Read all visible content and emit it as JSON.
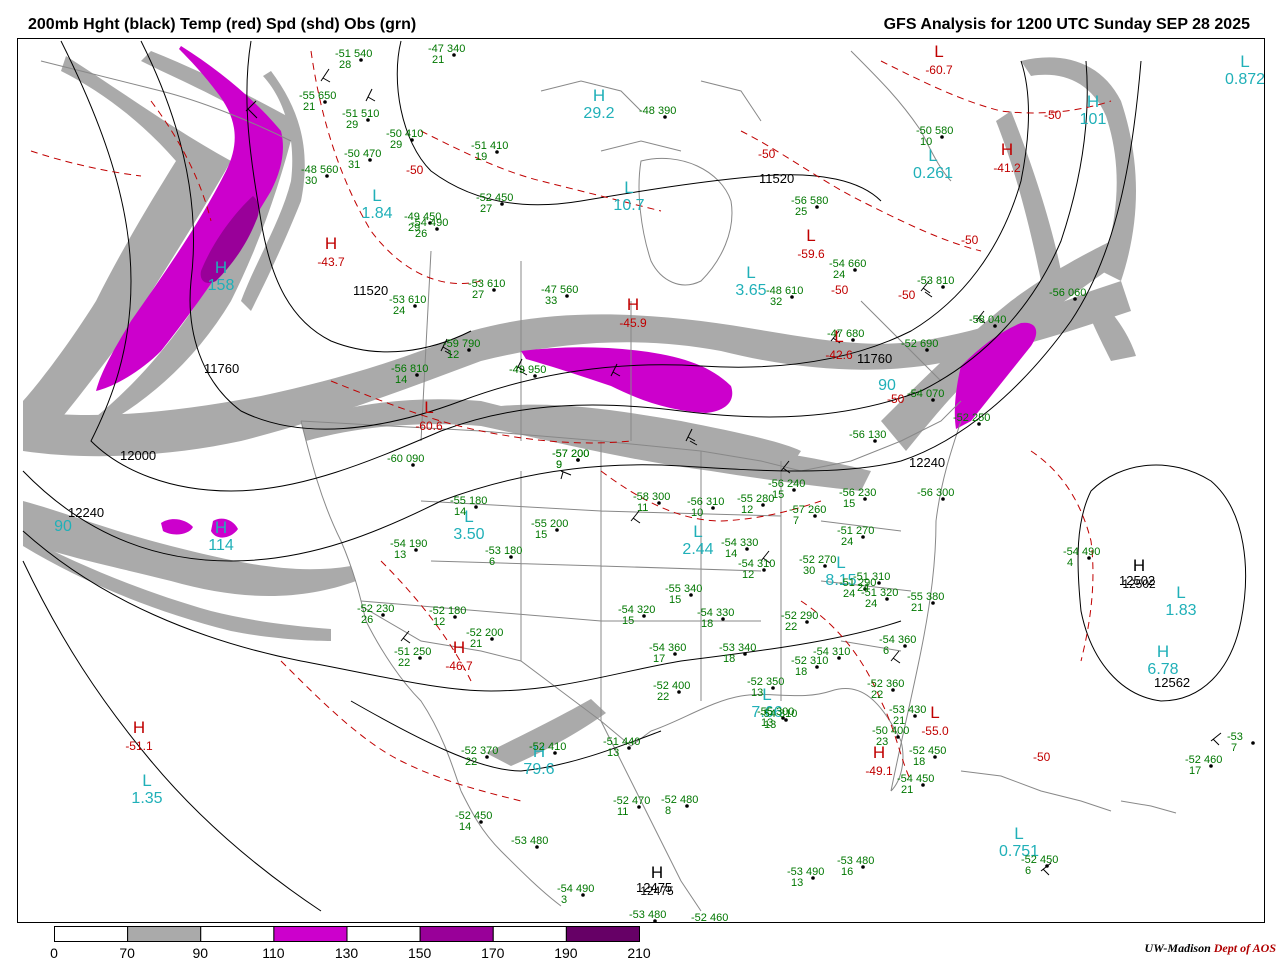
{
  "header": {
    "left": "200mb Hght (black) Temp (red) Spd (shd) Obs (grn)",
    "right": "GFS Analysis for 1200 UTC Sunday  SEP 28 2025"
  },
  "colors": {
    "height_contour": "#000000",
    "temp_contour": "#c00000",
    "obs": "#007700",
    "pressure_center": "#20b0b8",
    "boundary": "#888888",
    "wind_70_90": "#aaaaaa",
    "wind_90_110": "#ffffff",
    "wind_110_130": "#cc00cc",
    "wind_130_150": "#ffffff",
    "wind_150_170": "#990099",
    "wind_170_190": "#ffffff",
    "wind_190_210": "#660066"
  },
  "legend": {
    "ticks": [
      "0",
      "70",
      "90",
      "110",
      "130",
      "150",
      "170",
      "190",
      "210"
    ],
    "fills": [
      "#ffffff",
      "#aaaaaa",
      "#ffffff",
      "#cc00cc",
      "#ffffff",
      "#990099",
      "#ffffff",
      "#660066"
    ]
  },
  "height_labels": [
    "11520",
    "11520",
    "11760",
    "11760",
    "12000",
    "12240",
    "12240",
    "12502",
    "12475",
    "12562"
  ],
  "centers": [
    {
      "sym": "H",
      "value": "29.2",
      "color": "cyan"
    },
    {
      "sym": "L",
      "value": "10.7",
      "color": "cyan"
    },
    {
      "sym": "L",
      "value": "3.65",
      "color": "cyan"
    },
    {
      "sym": "L",
      "value": "0.261",
      "color": "cyan"
    },
    {
      "sym": "H",
      "value": "101",
      "color": "cyan"
    },
    {
      "sym": "L",
      "value": "0.872",
      "color": "cyan"
    },
    {
      "sym": "L",
      "value": "1.84",
      "color": "cyan"
    },
    {
      "sym": "L",
      "value": "3.50",
      "color": "cyan"
    },
    {
      "sym": "L",
      "value": "2.44",
      "color": "cyan"
    },
    {
      "sym": "L",
      "value": "8.15",
      "color": "cyan"
    },
    {
      "sym": "L",
      "value": "1.83",
      "color": "cyan"
    },
    {
      "sym": "H",
      "value": "6.78",
      "color": "cyan"
    },
    {
      "sym": "L",
      "value": "0.751",
      "color": "cyan"
    },
    {
      "sym": "L",
      "value": "1.35",
      "color": "cyan"
    },
    {
      "sym": "H",
      "value": "79.6",
      "color": "cyan"
    },
    {
      "sym": "L",
      "value": "7.66",
      "color": "cyan"
    },
    {
      "sym": "H",
      "value": "158",
      "color": "cyan"
    },
    {
      "sym": "H",
      "value": "114",
      "color": "cyan"
    },
    {
      "sym": "",
      "value": "90",
      "color": "cyan"
    },
    {
      "sym": "",
      "value": "90",
      "color": "cyan"
    },
    {
      "sym": "H",
      "value": "-43.7",
      "color": "red"
    },
    {
      "sym": "H",
      "value": "-45.9",
      "color": "red"
    },
    {
      "sym": "L",
      "value": "-60.7",
      "color": "red"
    },
    {
      "sym": "H",
      "value": "-41.2",
      "color": "red"
    },
    {
      "sym": "L",
      "value": "-59.6",
      "color": "red"
    },
    {
      "sym": "L",
      "value": "-60.6",
      "color": "red"
    },
    {
      "sym": "H",
      "value": "-46.7",
      "color": "red"
    },
    {
      "sym": "H",
      "value": "-51.1",
      "color": "red"
    },
    {
      "sym": "L",
      "value": "-55.0",
      "color": "red"
    },
    {
      "sym": "H",
      "value": "-49.1",
      "color": "red"
    },
    {
      "sym": "L",
      "value": "-42.6",
      "color": "red"
    },
    {
      "sym": "H",
      "value": "12502",
      "color": "black"
    },
    {
      "sym": "H",
      "value": "12475",
      "color": "black"
    }
  ],
  "temp_labels": [
    "-50",
    "-50",
    "-50",
    "-50",
    "-50",
    "-50",
    "-50",
    "-50"
  ],
  "observations": [
    [
      "-51",
      "540",
      "28"
    ],
    [
      "-47",
      "340",
      "21"
    ],
    [
      "-48",
      "390",
      ""
    ],
    [
      "-55",
      "650",
      "21"
    ],
    [
      "-51",
      "510",
      "29"
    ],
    [
      "-50",
      "410",
      "29"
    ],
    [
      "-51",
      "410",
      "19"
    ],
    [
      "-52",
      "450",
      "27"
    ],
    [
      "-50",
      "470",
      "31"
    ],
    [
      "-48",
      "560",
      "30"
    ],
    [
      "-49",
      "450",
      "29"
    ],
    [
      "-50",
      "580",
      "10"
    ],
    [
      "-56",
      "580",
      "25"
    ],
    [
      "-54",
      "490",
      "26"
    ],
    [
      "-53",
      "610",
      "27"
    ],
    [
      "-47",
      "560",
      "33"
    ],
    [
      "-54",
      "660",
      "24"
    ],
    [
      "-48",
      "610",
      "32"
    ],
    [
      "-53",
      "810",
      ""
    ],
    [
      "-56",
      "060",
      ""
    ],
    [
      "-53",
      "610",
      "24"
    ],
    [
      "-58",
      "040",
      ""
    ],
    [
      "-59",
      "790",
      "12"
    ],
    [
      "-52",
      "690",
      ""
    ],
    [
      "-56",
      "810",
      "14"
    ],
    [
      "-49",
      "950",
      ""
    ],
    [
      "-47",
      "680",
      ""
    ],
    [
      "-52",
      "250",
      ""
    ],
    [
      "-54",
      "070",
      ""
    ],
    [
      "-56",
      "130",
      ""
    ],
    [
      "-60",
      "090",
      ""
    ],
    [
      "-57",
      "200",
      "9"
    ],
    [
      "-57",
      "200",
      "9"
    ],
    [
      "-56",
      "240",
      "15"
    ],
    [
      "-56",
      "230",
      "15"
    ],
    [
      "-55",
      "180",
      "14"
    ],
    [
      "-58",
      "300",
      "11"
    ],
    [
      "-56",
      "310",
      "10"
    ],
    [
      "-55",
      "280",
      "12"
    ],
    [
      "-57",
      "260",
      "7"
    ],
    [
      "-56",
      "300",
      ""
    ],
    [
      "-54",
      "190",
      "13"
    ],
    [
      "-55",
      "200",
      "15"
    ],
    [
      "-53",
      "180",
      "6"
    ],
    [
      "-54",
      "330",
      "14"
    ],
    [
      "-51",
      "270",
      "24"
    ],
    [
      "-51",
      "290",
      "24"
    ],
    [
      "-54",
      "310",
      "12"
    ],
    [
      "-52",
      "270",
      "30"
    ],
    [
      "-51",
      "310",
      "24"
    ],
    [
      "-51",
      "320",
      "24"
    ],
    [
      "-55",
      "380",
      "21"
    ],
    [
      "-54",
      "490",
      "4"
    ],
    [
      "-52",
      "230",
      "26"
    ],
    [
      "-52",
      "180",
      "12"
    ],
    [
      "-55",
      "340",
      "15"
    ],
    [
      "-54",
      "320",
      "15"
    ],
    [
      "-54",
      "330",
      "18"
    ],
    [
      "-52",
      "290",
      "22"
    ],
    [
      "-52",
      "200",
      "21"
    ],
    [
      "-51",
      "250",
      "22"
    ],
    [
      "-54",
      "360",
      "17"
    ],
    [
      "-53",
      "340",
      "18"
    ],
    [
      "-52",
      "310",
      "18"
    ],
    [
      "-54",
      "310",
      ""
    ],
    [
      "-54",
      "360",
      "6"
    ],
    [
      "-52",
      "360",
      "22"
    ],
    [
      "-52",
      "400",
      "22"
    ],
    [
      "-52",
      "350",
      "13"
    ],
    [
      "-55",
      "300",
      "13"
    ],
    [
      "-54",
      "310",
      "13"
    ],
    [
      "-53",
      "430",
      "21"
    ],
    [
      "-50",
      "400",
      "23"
    ],
    [
      "-52",
      "450",
      "18"
    ],
    [
      "-52",
      "370",
      "22"
    ],
    [
      "-52",
      "410",
      ""
    ],
    [
      "-51",
      "440",
      "13"
    ],
    [
      "-52",
      "470",
      "11"
    ],
    [
      "-52",
      "480",
      "8"
    ],
    [
      "-54",
      "450",
      "21"
    ],
    [
      "-52",
      "460",
      "17"
    ],
    [
      "-53",
      "",
      "7"
    ],
    [
      "-52",
      "450",
      "14"
    ],
    [
      "-53",
      "480",
      ""
    ],
    [
      "-54",
      "490",
      "3"
    ],
    [
      "-53",
      "480",
      ""
    ],
    [
      "-52",
      "460",
      ""
    ],
    [
      "-53",
      "490",
      "13"
    ],
    [
      "-53",
      "480",
      "16"
    ],
    [
      "-52",
      "450",
      "6"
    ]
  ],
  "credit": {
    "org": "UW-Madison",
    "dept": "Dept of AOS"
  }
}
